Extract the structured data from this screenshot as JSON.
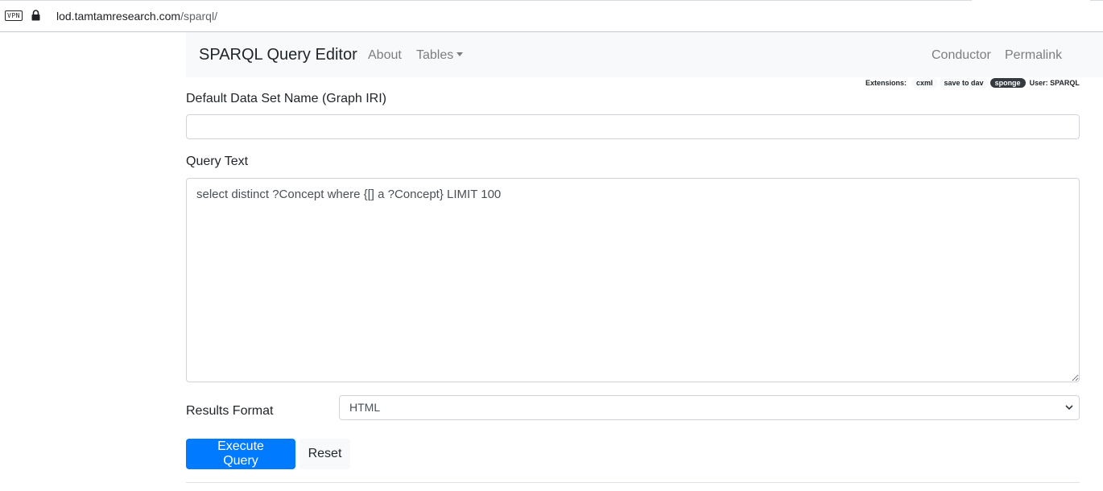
{
  "browser": {
    "vpn_label": "VPN",
    "url_host": "lod.tamtamresearch.com",
    "url_path": "/sparql/"
  },
  "navbar": {
    "brand": "SPARQL Query Editor",
    "links": [
      {
        "label": "About"
      },
      {
        "label": "Tables",
        "has_dropdown": true
      },
      {
        "label": "Conductor"
      },
      {
        "label": "Permalink"
      }
    ]
  },
  "extensions": {
    "label": "Extensions:",
    "items": [
      {
        "label": "cxml",
        "active": false
      },
      {
        "label": "save to dav",
        "active": false
      },
      {
        "label": "sponge",
        "active": true
      }
    ],
    "user": "User: SPARQL"
  },
  "form": {
    "graph_label": "Default Data Set Name (Graph IRI)",
    "graph_value": "",
    "query_label": "Query Text",
    "query_value": "select distinct ?Concept where {[] a ?Concept} LIMIT 100",
    "format_label": "Results Format",
    "format_selected": "HTML",
    "execute_label": "Execute Query",
    "reset_label": "Reset"
  },
  "colors": {
    "primary": "#007bff",
    "navbar_bg": "#f8f9fa",
    "active_pill": "#343a40"
  }
}
